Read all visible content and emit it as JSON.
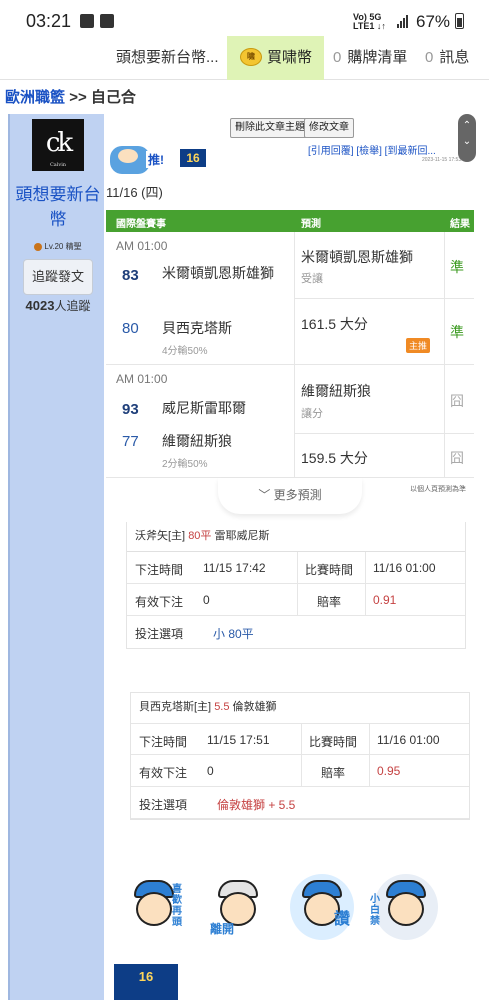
{
  "status_bar": {
    "time": "03:21",
    "network_top": "Vo) 5G",
    "network_bottom": "LTE1 ↓↑",
    "battery": "67%"
  },
  "top_nav": {
    "user_tab": "頭想要新台幣...",
    "buy_tab": "買啸幣",
    "buy_icon_text": "啸",
    "list_count": "0",
    "list_tab": "購牌清單",
    "msg_count": "0",
    "msg_tab": "訊息"
  },
  "breadcrumb": {
    "league": "歐洲職籃",
    "separator": ">>",
    "current": "自己合"
  },
  "author": {
    "avatar_text": "ck",
    "avatar_sub": "Calvin",
    "name": "頭想要新台幣",
    "level": "Lv.20 精聖",
    "follow_label": "追蹤發文",
    "followers_count": "4023",
    "followers_suffix": "人追蹤"
  },
  "post": {
    "delete_btn": "刪除此文章主題",
    "edit_btn": "修改文章",
    "push_label": "推!",
    "push_count": "16",
    "links": "[引用回覆]  [檢舉]  [到最新回...",
    "post_time": "2023-11-15 17:53:38",
    "game_date": "11/16 (四)"
  },
  "predictions": {
    "headers": {
      "game": "國際盤賽事",
      "pick": "預測",
      "result": "結果"
    },
    "games": [
      {
        "time": "AM 01:00",
        "away_score": "83",
        "away_team": "米爾頓凱恩斯雄獅",
        "home_score": "80",
        "home_team": "貝西克塔斯",
        "home_note": "4分輸50%",
        "pick1": "米爾頓凱恩斯雄獅",
        "pick1_note": "受讓",
        "result1": "準",
        "pick2": "161.5 大分",
        "pick2_tag": "主推",
        "result2": "準"
      },
      {
        "time": "AM 01:00",
        "away_score": "93",
        "away_team": "威尼斯雷耶爾",
        "home_score": "77",
        "home_team": "維爾紐斯狼",
        "home_note": "2分輸50%",
        "pick1": "維爾紐斯狼",
        "pick1_note": "讓分",
        "result1": "囧",
        "pick2": "159.5 大分",
        "result2": "囧"
      }
    ],
    "more_label": "更多預測",
    "more_note": "以個人頁預測為準"
  },
  "bets": [
    {
      "title_prefix": "沃斧矢[主]",
      "title_line": "80平",
      "title_suffix": "雷耶威尼斯",
      "bet_time_label": "下注時間",
      "bet_time": "11/15 17:42",
      "game_time_label": "比賽時間",
      "game_time": "11/16 01:00",
      "valid_label": "有效下注",
      "valid_value": "0",
      "odds_label": "賠率",
      "odds_value": "0.91",
      "option_label": "投注選項",
      "option_value": "小 80平"
    },
    {
      "title_prefix": "貝西克塔斯[主]",
      "title_line": "5.5",
      "title_suffix": "倫敦雄獅",
      "bet_time_label": "下注時間",
      "bet_time": "11/15 17:51",
      "game_time_label": "比賽時間",
      "game_time": "11/16 01:00",
      "valid_label": "有效下注",
      "valid_value": "0",
      "odds_label": "賠率",
      "odds_value": "0.95",
      "option_label": "投注選項",
      "option_value": "倫敦雄獅 + 5.5"
    }
  ],
  "stickers": [
    {
      "icon": "sticker-happy-icon",
      "text": "喜歡再頭"
    },
    {
      "icon": "sticker-leave-icon",
      "text": "離開"
    },
    {
      "icon": "sticker-praise-icon",
      "text": "讚"
    },
    {
      "icon": "sticker-cry-icon",
      "text": "小白禁"
    }
  ],
  "bottom_badge": "16",
  "colors": {
    "accent_blue": "#1a52c4",
    "header_green": "#47a130",
    "win_green": "#3d9b22",
    "odds_red": "#c54242",
    "sidebar_blue": "#bfd2f2"
  }
}
